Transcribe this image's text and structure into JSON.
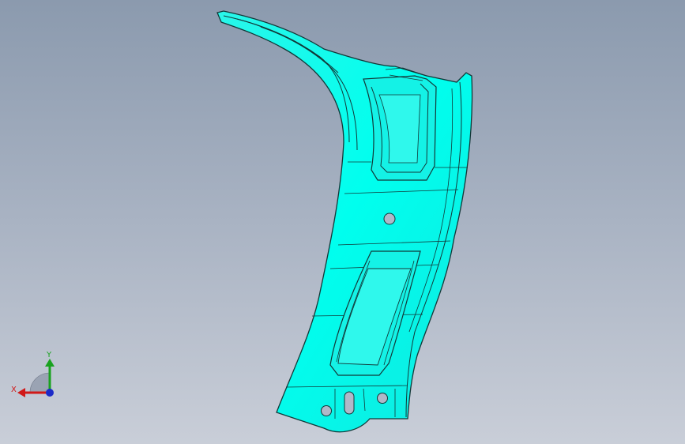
{
  "viewport": {
    "name": "3D model view",
    "part_color": "#00ffee",
    "edge_color": "#123838"
  },
  "triad": {
    "x_label": "X",
    "y_label": "Y",
    "x_color": "#d01818",
    "y_color": "#19a21f",
    "z_color": "#1b2ac8"
  }
}
